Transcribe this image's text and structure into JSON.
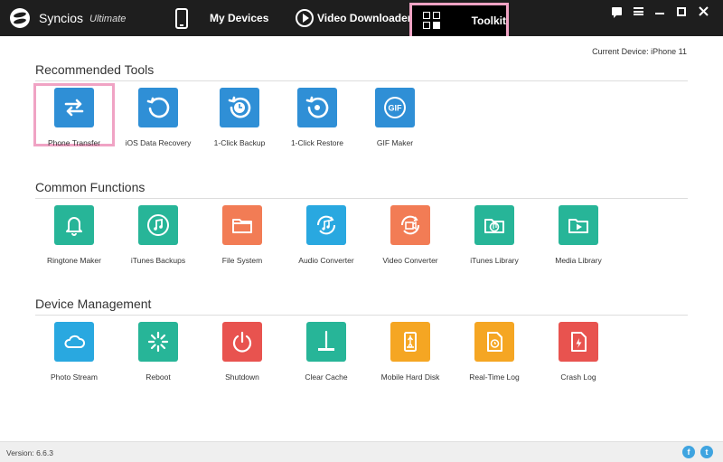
{
  "app": {
    "name": "Syncios",
    "edition": "Ultimate"
  },
  "nav": {
    "tabs": [
      {
        "label": "My Devices",
        "icon": "phone-icon"
      },
      {
        "label": "Video Downloader",
        "icon": "play-icon"
      },
      {
        "label": "Toolkit",
        "icon": "grid-icon",
        "active": true
      }
    ]
  },
  "device": {
    "current": "Current Device: iPhone 11"
  },
  "sections": [
    {
      "title": "Recommended Tools",
      "tools": [
        {
          "label": "Phone Transfer",
          "icon": "transfer-arrows-icon",
          "color": "#2f8fd6"
        },
        {
          "label": "iOS Data Recovery",
          "icon": "recovery-icon",
          "color": "#2f8fd6"
        },
        {
          "label": "1-Click Backup",
          "icon": "backup-clock-icon",
          "color": "#2f8fd6"
        },
        {
          "label": "1-Click Restore",
          "icon": "restore-icon",
          "color": "#2f8fd6"
        },
        {
          "label": "GIF Maker",
          "icon": "gif-icon",
          "color": "#2f8fd6"
        }
      ]
    },
    {
      "title": "Common Functions",
      "tools": [
        {
          "label": "Ringtone Maker",
          "icon": "bell-icon",
          "color": "#27b598"
        },
        {
          "label": "iTunes Backups",
          "icon": "music-note-icon",
          "color": "#27b598"
        },
        {
          "label": "File System",
          "icon": "folder-icon",
          "color": "#f27c55"
        },
        {
          "label": "Audio Converter",
          "icon": "audio-convert-icon",
          "color": "#29a8e0"
        },
        {
          "label": "Video Converter",
          "icon": "video-convert-icon",
          "color": "#f27c55"
        },
        {
          "label": "iTunes Library",
          "icon": "music-folder-icon",
          "color": "#27b598"
        },
        {
          "label": "Media Library",
          "icon": "media-folder-icon",
          "color": "#27b598"
        }
      ]
    },
    {
      "title": "Device Management",
      "tools": [
        {
          "label": "Photo Stream",
          "icon": "cloud-icon",
          "color": "#29a8e0"
        },
        {
          "label": "Reboot",
          "icon": "reboot-icon",
          "color": "#27b598"
        },
        {
          "label": "Shutdown",
          "icon": "power-icon",
          "color": "#e8534f"
        },
        {
          "label": "Clear Cache",
          "icon": "broom-icon",
          "color": "#27b598"
        },
        {
          "label": "Mobile Hard Disk",
          "icon": "usb-disk-icon",
          "color": "#f5a623"
        },
        {
          "label": "Real-Time Log",
          "icon": "realtime-log-icon",
          "color": "#f5a623"
        },
        {
          "label": "Crash Log",
          "icon": "crash-log-icon",
          "color": "#e8534f"
        }
      ]
    }
  ],
  "footer": {
    "version": "Version: 6.6.3",
    "social": [
      {
        "label": "f",
        "icon": "facebook-icon"
      },
      {
        "label": "t",
        "icon": "twitter-icon"
      }
    ]
  }
}
